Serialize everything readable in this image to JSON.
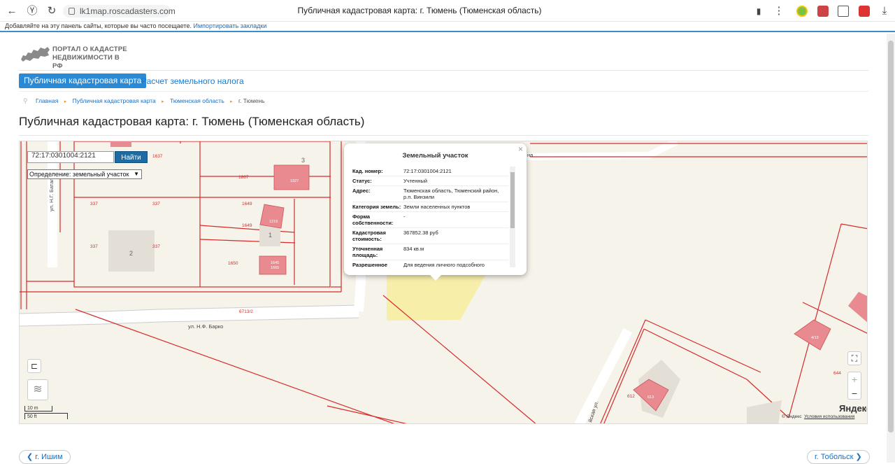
{
  "browser": {
    "url": "lk1map.roscadasters.com",
    "tab_title": "Публичная кадастровая карта: г. Тюмень (Тюменская область)",
    "bookmarks_hint": "Добавляйте на эту панель сайты, которые вы часто посещаете.",
    "bookmarks_link": "Импортировать закладки"
  },
  "site": {
    "logo_line1": "ПОРТАЛ О КАДАСТРЕ",
    "logo_line2": "НЕДВИЖИМОСТИ В РФ",
    "nav": {
      "active": "Публичная кадастровая карта",
      "link": "Расчет земельного налога"
    },
    "breadcrumbs": [
      "Главная",
      "Публичная кадастровая карта",
      "Тюменская область",
      "г. Тюмень"
    ],
    "page_title": "Публичная кадастровая карта: г. Тюмень (Тюменская область)"
  },
  "map": {
    "search_value": "72:17:0301004:2121",
    "search_button": "Найти",
    "definition_label": "Определение:",
    "definition_value": "земельный участок",
    "scale_m": "10 m",
    "scale_ft": "50 ft",
    "copyright": "© Яндекс",
    "terms": "Условия использования",
    "brand": "Яндекс",
    "zoom_in": "+",
    "zoom_out": "−",
    "labels": {
      "street1": "ул. Н.Ф. Барко",
      "street2": "ул. Н.Г. Батал",
      "street3": "йская ул.",
      "street_top": "на",
      "p1637": "1637",
      "p1867": "1867",
      "p1927": "1927",
      "p337a": "337",
      "p337b": "337",
      "p337c": "337",
      "p337d": "337",
      "p1649a": "1649",
      "p1649b": "1649",
      "p1219": "1219",
      "p1650": "1650",
      "p1645": "1645",
      "p1665": "1665",
      "p6713": "6713/2",
      "n3": "3",
      "n2": "2",
      "n1": "1",
      "p644": "644",
      "p612": "612",
      "p613": "613",
      "p413": "4/13"
    },
    "popup": {
      "title": "Земельный участок",
      "rows": [
        {
          "k": "Кад. номер:",
          "v": "72:17:0301004:2121"
        },
        {
          "k": "Статус:",
          "v": "Учтенный"
        },
        {
          "k": "Адрес:",
          "v": "Тюменская область, Тюменский район, р.п. Винзили"
        },
        {
          "k": "Категория земель:",
          "v": "Земли населенных пунктов"
        },
        {
          "k": "Форма собственности:",
          "v": "-"
        },
        {
          "k": "Кадастровая стоимость:",
          "v": "367852.38 руб"
        },
        {
          "k": "Уточненная площадь:",
          "v": "834 кв.м"
        },
        {
          "k": "Разрешенное",
          "v": "Для ведения личного подсобного"
        }
      ]
    }
  },
  "pager": {
    "prev": "г. Ишим",
    "next": "г. Тобольск"
  },
  "colors": {
    "accent": "#2a8ad6",
    "cadastre_line": "#d62b2b",
    "parcel_fill": "#e88a8f",
    "selected_parcel": "#f7eeaa"
  }
}
